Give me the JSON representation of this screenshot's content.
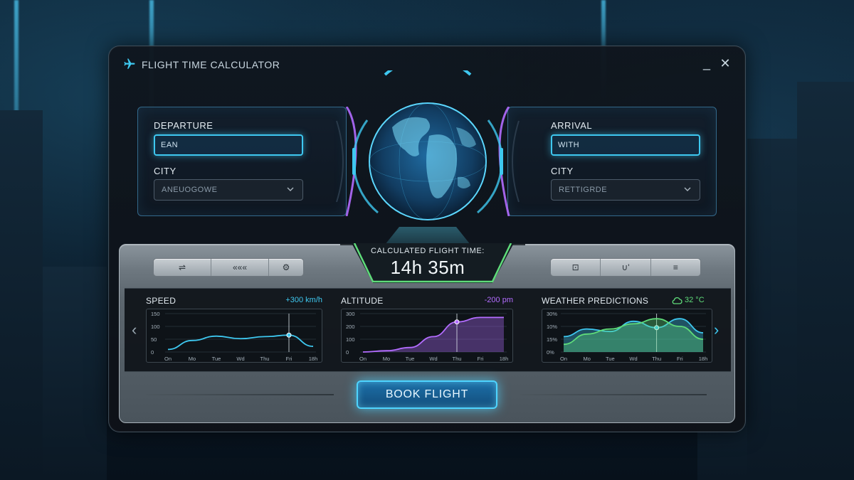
{
  "window": {
    "title": "FLIGHT TIME CALCULATOR",
    "minimize_label": "_",
    "close_label": "✕"
  },
  "departure": {
    "label": "DEPARTURE",
    "input_value": "EAN",
    "city_label": "CITY",
    "city_value": "ANEUOGOWE"
  },
  "arrival": {
    "label": "ARRIVAL",
    "input_value": "WITH",
    "city_label": "CITY",
    "city_value": "RETTIGRDE"
  },
  "result": {
    "label": "CALCULATED FLIGHT TIME:",
    "value": "14h 35m"
  },
  "toolbar_left": {
    "items": [
      "⇌",
      "«««",
      "⚙"
    ]
  },
  "toolbar_right": {
    "items": [
      "⊡",
      "∪'",
      "≡"
    ]
  },
  "charts": {
    "speed": {
      "title": "SPEED",
      "meta": "+300 km/h",
      "meta_color": "#3ec8f0",
      "line_color": "#3ec8f0",
      "y_ticks": [
        "150",
        "100",
        "50",
        "0"
      ],
      "x_ticks": [
        "On",
        "Mo",
        "Tue",
        "Wd",
        "Thu",
        "Fri",
        "18h"
      ]
    },
    "altitude": {
      "title": "ALTITUDE",
      "meta": "-200 pm",
      "meta_color": "#b36cff",
      "line_color": "#b36cff",
      "y_ticks": [
        "300",
        "200",
        "100",
        "0"
      ],
      "x_ticks": [
        "On",
        "Mo",
        "Tue",
        "Wd",
        "Thu",
        "Fri",
        "18h"
      ]
    },
    "weather": {
      "title": "WEATHER PREDICTIONS",
      "meta": "32 °C",
      "meta_color": "#5fdc7a",
      "cloud_icon": "cloud-icon",
      "y_ticks": [
        "30%",
        "10%",
        "15%",
        "0%"
      ],
      "x_ticks": [
        "On",
        "Mo",
        "Tue",
        "Wd",
        "Thu",
        "Fri",
        "18h"
      ]
    }
  },
  "chart_data": [
    {
      "type": "line",
      "title": "SPEED",
      "x": [
        "On",
        "Mo",
        "Tue",
        "Wd",
        "Thu",
        "Fri",
        "18h"
      ],
      "series": [
        {
          "values": [
            10,
            45,
            62,
            52,
            60,
            66,
            22
          ]
        }
      ],
      "ylim": [
        0,
        150
      ]
    },
    {
      "type": "area",
      "title": "ALTITUDE",
      "x": [
        "On",
        "Mo",
        "Tue",
        "Wd",
        "Thu",
        "Fri",
        "18h"
      ],
      "series": [
        {
          "values": [
            0,
            10,
            35,
            120,
            235,
            270,
            270
          ]
        }
      ],
      "ylim": [
        0,
        300
      ]
    },
    {
      "type": "area",
      "title": "WEATHER PREDICTIONS",
      "x": [
        "On",
        "Mo",
        "Tue",
        "Wd",
        "Thu",
        "Fri",
        "18h"
      ],
      "series": [
        {
          "values": [
            12,
            18,
            16,
            24,
            19,
            26,
            15
          ]
        },
        {
          "values": [
            6,
            14,
            18,
            22,
            26,
            20,
            10
          ]
        }
      ],
      "ylim": [
        0,
        30
      ]
    }
  ],
  "book_button": {
    "label": "BOOK FLIGHT"
  },
  "colors": {
    "accent_cyan": "#3ec8f0",
    "accent_purple": "#b36cff",
    "accent_green": "#5fdc7a"
  }
}
